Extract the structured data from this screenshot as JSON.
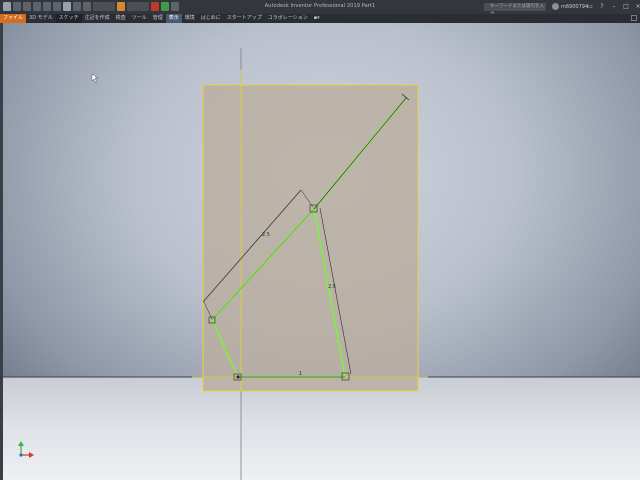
{
  "app": {
    "title": "Autodesk Inventor Professional 2019   Part1",
    "search_placeholder": "キーワードまたは語句を入力",
    "user_name": "m6900794",
    "help_label": "?"
  },
  "ribbon": {
    "tabs": [
      {
        "label": "ファイル"
      },
      {
        "label": "3D モデル"
      },
      {
        "label": "スケッチ"
      },
      {
        "label": "注記を作成"
      },
      {
        "label": "検査"
      },
      {
        "label": "ツール"
      },
      {
        "label": "管理"
      },
      {
        "label": "表示"
      },
      {
        "label": "環境"
      },
      {
        "label": "はじめに"
      },
      {
        "label": "スタートアップ"
      },
      {
        "label": "コラボレーション"
      }
    ],
    "active_tab": "表示"
  },
  "sketch": {
    "dimension_labels": {
      "long_edge": "2.5",
      "vertical_edge": "2.5",
      "bottom_edge": "1"
    },
    "line_color": "#7cf23a",
    "dimension_color": "#2b2b2b",
    "sketch_plane_color": "#b9ad9f",
    "plane_border_color": "#e6d43a"
  },
  "triad": {
    "x_label": "X",
    "y_label": "Y"
  }
}
